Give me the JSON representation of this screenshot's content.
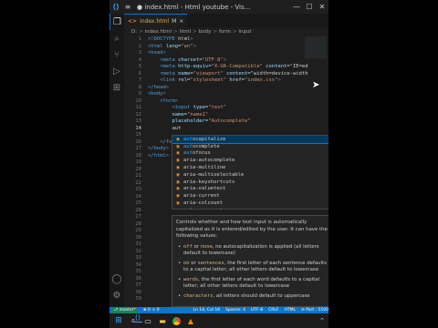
{
  "window": {
    "title": "● index.html - Html youtube - Vis...",
    "controls": {
      "minimize": "—",
      "maximize": "☐",
      "close": "✕"
    }
  },
  "tabs": [
    {
      "label": "index.html",
      "modified_marker": "M",
      "close": "×"
    }
  ],
  "breadcrumb": [
    "D:",
    ">",
    "index.html",
    ">",
    "html",
    ">",
    "body",
    ">",
    "form",
    ">",
    "input"
  ],
  "editor": {
    "line_numbers": [
      "1",
      "2",
      "3",
      "4",
      "5",
      "6",
      "7",
      "8",
      "9",
      "10",
      "11",
      "12",
      "13",
      "14",
      "15",
      "16",
      "17",
      "18",
      "19",
      "20",
      "21",
      "22",
      "23",
      "24",
      "25",
      "26",
      "27",
      "28",
      "29",
      "30",
      "31",
      "32",
      "33",
      "34",
      "35",
      "36",
      "37",
      "38",
      "39"
    ],
    "current_line": "14",
    "lines": [
      "<!DOCTYPE html>",
      "<html lang=\"en\">",
      "<head>",
      "    <meta charset=\"UTF-8\">",
      "    <meta http-equiv=\"X-UA-Compatible\" content=\"IE=ed",
      "    <meta name=\"viewport\" content=\"width=device-width",
      "    <link rel=\"stylesheet\" href=\"index.css\">",
      "</head>",
      "<body>",
      "    <form>",
      "        <input type=\"text\"",
      "        name=\"name1\"",
      "        placeholder=\"Autocomplete\"",
      "        aut",
      "",
      "    </fo",
      "</body>",
      "</html>"
    ]
  },
  "suggestions": {
    "typed": "aut",
    "items": [
      "autocapitalize",
      "autocomplete",
      "autofocus",
      "aria-autocomplete",
      "aria-multiline",
      "aria-multiselectable",
      "aria-keyshortcuts",
      "aria-valuetext",
      "aria-current",
      "aria-colcount",
      "aria-rowcount"
    ],
    "selected_index": 0
  },
  "docs": {
    "intro": "Controls whether and how text input is automatically capitalized as it is entered/edited by the user. It can have the following values:",
    "close": "×",
    "bullets": [
      {
        "code": "off",
        "mid": " or ",
        "code2": "none",
        "text": ", no autocapitalization is applied (all letters default to lowercase)"
      },
      {
        "code": "on",
        "mid": " or ",
        "code2": "sentences",
        "text": ", the first letter of each sentence defaults to a capital letter; all other letters default to lowercase"
      },
      {
        "code": "words",
        "mid": "",
        "code2": "",
        "text": ", the first letter of each word defaults to a capital letter; all other letters default to lowercase"
      },
      {
        "code": "characters",
        "mid": "",
        "code2": "",
        "text": ", all letters should default to uppercase"
      }
    ]
  },
  "status_bar": {
    "remote": "⎇ master*",
    "errors": "⊗ 0 ⚠ 0",
    "position": "Ln 14, Col 16",
    "spaces": "Spaces: 4",
    "encoding": "UTF-8",
    "eol": "CRLF",
    "language": "HTML",
    "port": "⊘ Port : 5500"
  },
  "taskbar": {
    "icons": [
      "windows-start",
      "search",
      "task-view",
      "file-explorer",
      "vscode",
      "chrome",
      "vlc"
    ],
    "tray": "⌃"
  },
  "colors": {
    "accent": "#0078d4",
    "editor_bg": "#1e1e1e",
    "tag": "#569cd6",
    "attribute": "#9cdcfe",
    "string": "#ce9178"
  }
}
